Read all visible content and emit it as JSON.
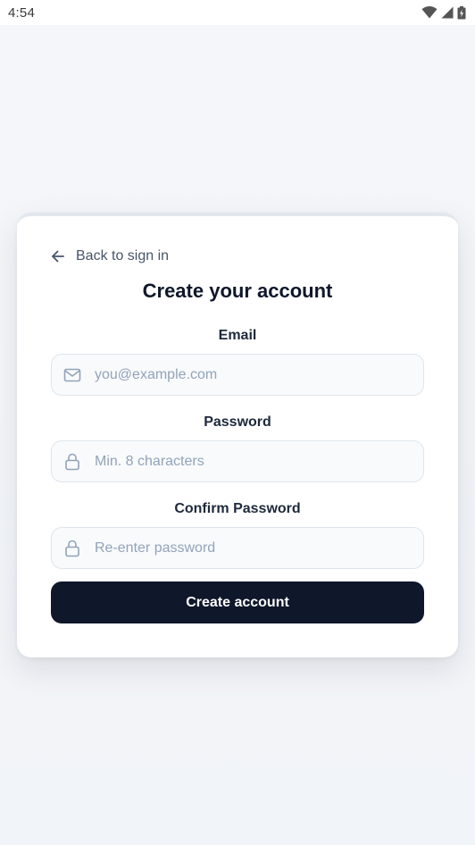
{
  "status_bar": {
    "time": "4:54",
    "icons": [
      "wifi-icon",
      "signal-icon",
      "battery-icon"
    ]
  },
  "form": {
    "back_label": "Back to sign in",
    "title": "Create your account",
    "fields": [
      {
        "label": "Email",
        "placeholder": "you@example.com",
        "value": "",
        "icon": "mail-icon"
      },
      {
        "label": "Password",
        "placeholder": "Min. 8 characters",
        "value": "",
        "icon": "lock-icon"
      },
      {
        "label": "Confirm Password",
        "placeholder": "Re-enter password",
        "value": "",
        "icon": "lock-icon"
      }
    ],
    "submit_label": "Create account"
  },
  "colors": {
    "primary": "#0f172a",
    "background": "#f3f5f8",
    "card": "#ffffff",
    "input_bg": "#f8fafc",
    "placeholder": "#94a3b8",
    "muted_text": "#475569"
  }
}
